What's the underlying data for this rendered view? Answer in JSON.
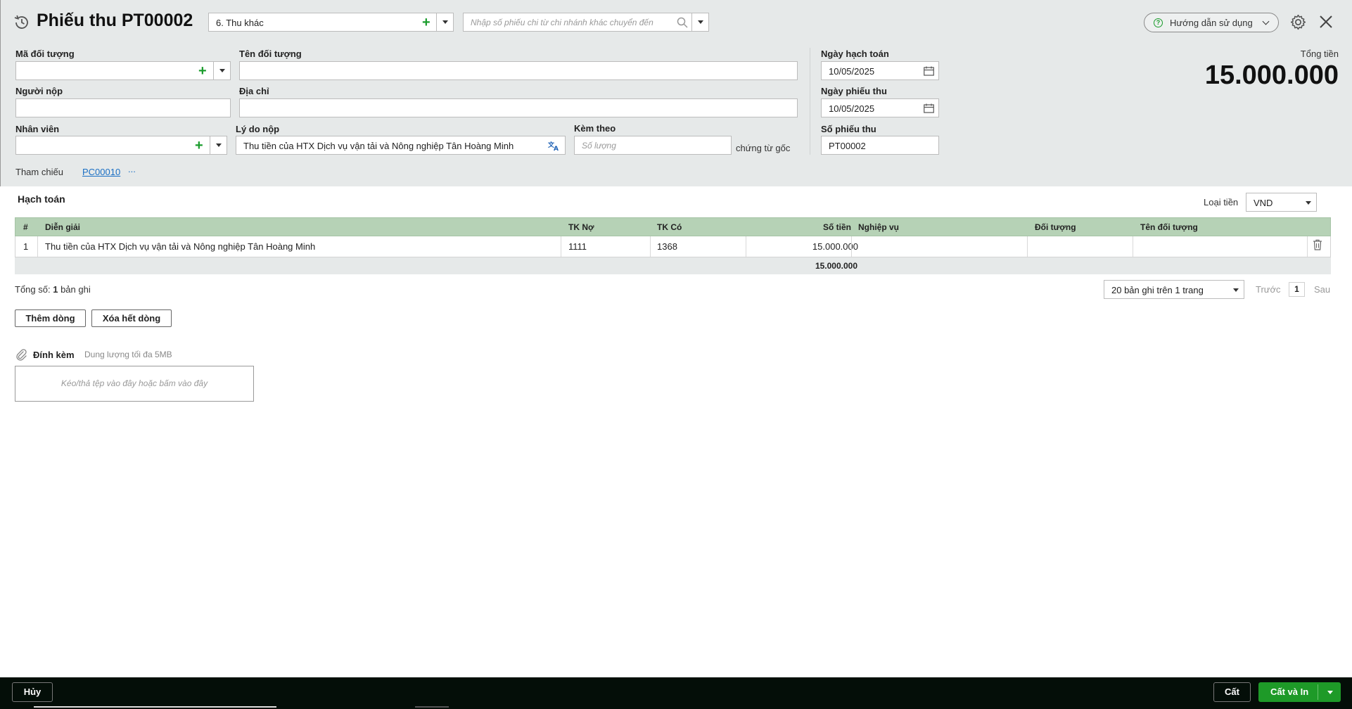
{
  "header": {
    "title": "Phiếu thu PT00002",
    "type_select": "6. Thu khác",
    "search_placeholder": "Nhập số phiếu chi từ chi nhánh khác chuyển đến",
    "guide_label": "Hướng dẫn sử dụng"
  },
  "form": {
    "ma_doi_tuong_label": "Mã đối tượng",
    "ma_doi_tuong_value": "",
    "ten_doi_tuong_label": "Tên đối tượng",
    "ten_doi_tuong_value": "",
    "nguoi_nop_label": "Người nộp",
    "nguoi_nop_value": "",
    "dia_chi_label": "Địa chỉ",
    "dia_chi_value": "",
    "nhan_vien_label": "Nhân viên",
    "nhan_vien_value": "",
    "ly_do_label": "Lý do nộp",
    "ly_do_value": "Thu tiền của HTX Dịch vụ vận tải và Nông nghiệp Tân Hoàng Minh",
    "kem_theo_label": "Kèm theo",
    "kem_theo_placeholder": "Số lượng",
    "chung_tu_goc": "chứng từ gốc",
    "ngay_hach_toan_label": "Ngày hạch toán",
    "ngay_hach_toan_value": "10/05/2025",
    "ngay_phieu_thu_label": "Ngày phiếu thu",
    "ngay_phieu_thu_value": "10/05/2025",
    "so_phieu_thu_label": "Số phiếu thu",
    "so_phieu_thu_value": "PT00002",
    "tong_tien_label": "Tổng tiền",
    "tong_tien_value": "15.000.000",
    "tham_chieu_label": "Tham chiếu",
    "tham_chieu_link": "PC00010",
    "tham_chieu_more": "..."
  },
  "accounting": {
    "title": "Hạch toán",
    "currency_label": "Loại tiền",
    "currency_value": "VND",
    "columns": [
      "#",
      "Diễn giải",
      "TK Nợ",
      "TK Có",
      "Số tiền",
      "Nghiệp vụ",
      "Đối tượng",
      "Tên đối tượng"
    ],
    "rows": [
      {
        "no": "1",
        "dien_giai": "Thu tiền của HTX Dịch vụ vận tải và Nông nghiệp Tân Hoàng Minh",
        "tk_no": "1111",
        "tk_co": "1368",
        "so_tien": "15.000.000",
        "nghiep_vu": "",
        "doi_tuong": "",
        "ten_doi_tuong": ""
      }
    ],
    "total": "15.000.000",
    "total_records_prefix": "Tổng số:",
    "total_records_count": "1",
    "total_records_suffix": "bản ghi",
    "page_size": "20 bản ghi trên 1 trang",
    "prev": "Trước",
    "page": "1",
    "next": "Sau",
    "add_row": "Thêm dòng",
    "delete_all": "Xóa hết dòng"
  },
  "attachment": {
    "label": "Đính kèm",
    "note": "Dung lượng tối đa 5MB",
    "drop_text": "Kéo/thả tệp vào đây hoặc bấm vào đây"
  },
  "footer": {
    "cancel": "Hủy",
    "save": "Cất",
    "save_print": "Cất và In"
  },
  "colors": {
    "accent_green": "#1e9a28",
    "grid_header": "#b6d2b6",
    "link": "#1a6fc4",
    "footer_bg": "#040e08"
  }
}
